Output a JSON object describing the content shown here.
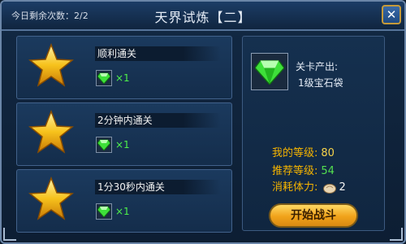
{
  "header": {
    "attempts_label": "今日剩余次数：",
    "attempts_value": "2/2",
    "title": "天界试炼【二】",
    "close_glyph": "✕"
  },
  "objectives": [
    {
      "name": "顺利通关",
      "reward_icon": "green-gem-icon",
      "reward_qty": "×1"
    },
    {
      "name": "2分钟内通关",
      "reward_icon": "green-gem-icon",
      "reward_qty": "×1"
    },
    {
      "name": "1分30秒内通关",
      "reward_icon": "green-gem-icon",
      "reward_qty": "×1"
    }
  ],
  "drop": {
    "icon": "green-gem-icon",
    "label": "关卡产出:",
    "item": "1级宝石袋"
  },
  "stats": {
    "my_level_label": "我的等级:",
    "my_level_value": "80",
    "recommended_level_label": "推荐等级:",
    "recommended_level_value": "54",
    "stamina_label": "消耗体力:",
    "stamina_icon": "stamina-bun-icon",
    "stamina_value": "2"
  },
  "start_button": {
    "label": "开始战斗"
  },
  "colors": {
    "gold": "#f5b400",
    "green": "#54e04f",
    "panel_blue": "#122944",
    "button_orange": "#f0a21a"
  }
}
